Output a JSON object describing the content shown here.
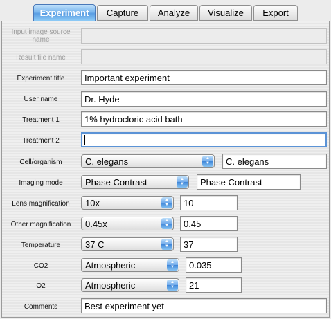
{
  "tabs": [
    {
      "label": "Experiment",
      "active": true
    },
    {
      "label": "Capture",
      "active": false
    },
    {
      "label": "Analyze",
      "active": false
    },
    {
      "label": "Visualize",
      "active": false
    },
    {
      "label": "Export",
      "active": false
    }
  ],
  "form": {
    "input_source": {
      "label": "Input image source name",
      "value": ""
    },
    "result_file": {
      "label": "Result file name",
      "value": ""
    },
    "experiment_title": {
      "label": "Experiment title",
      "value": "Important experiment"
    },
    "user_name": {
      "label": "User name",
      "value": "Dr. Hyde"
    },
    "treatment1": {
      "label": "Treatment 1",
      "value": "1% hydrocloric acid bath"
    },
    "treatment2": {
      "label": "Treatment 2",
      "value": ""
    },
    "cell_organism": {
      "label": "Cell/organism",
      "selected": "C. elegans",
      "value": "C. elegans"
    },
    "imaging_mode": {
      "label": "Imaging mode",
      "selected": "Phase Contrast",
      "value": "Phase Contrast"
    },
    "lens_magnification": {
      "label": "Lens magnification",
      "selected": "10x",
      "value": "10"
    },
    "other_magnification": {
      "label": "Other magnification",
      "selected": "0.45x",
      "value": "0.45"
    },
    "temperature": {
      "label": "Temperature",
      "selected": "37 C",
      "value": "37"
    },
    "co2": {
      "label": "CO2",
      "selected": "Atmospheric",
      "value": "0.035"
    },
    "o2": {
      "label": "O2",
      "selected": "Atmospheric",
      "value": "21"
    },
    "comments": {
      "label": "Comments",
      "value": "Best experiment yet"
    }
  }
}
